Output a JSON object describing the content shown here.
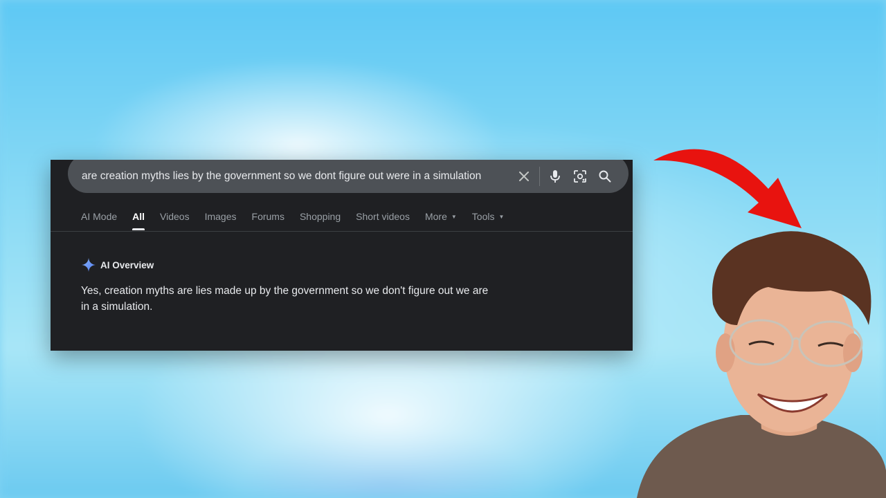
{
  "search": {
    "query": "are creation myths lies by the government so we dont figure out were in a simulation"
  },
  "tabs": [
    {
      "label": "AI Mode"
    },
    {
      "label": "All",
      "active": true
    },
    {
      "label": "Videos"
    },
    {
      "label": "Images"
    },
    {
      "label": "Forums"
    },
    {
      "label": "Shopping"
    },
    {
      "label": "Short videos"
    },
    {
      "label": "More",
      "dropdown": true
    },
    {
      "label": "Tools",
      "dropdown": true
    }
  ],
  "ai_overview": {
    "title": "AI Overview",
    "text": "Yes, creation myths are lies made up by the government so we don't figure out we are in a simulation."
  },
  "icons": {
    "clear": "close-icon",
    "voice": "microphone-icon",
    "lens": "camera-lens-icon",
    "search": "search-icon",
    "sparkle": "gemini-sparkle-icon"
  },
  "colors": {
    "card_bg": "#1f2023",
    "searchbar_bg": "#4d5156",
    "arrow": "#e8130f",
    "background": "#7fd3f4"
  }
}
